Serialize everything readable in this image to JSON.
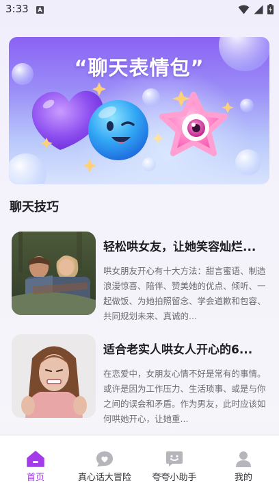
{
  "status_bar": {
    "time": "3:33",
    "a_badge": "A"
  },
  "banner": {
    "title": "“聊天表情包”"
  },
  "section": {
    "title": "聊天技巧"
  },
  "articles": [
    {
      "title": "轻松哄女友，让她笑容灿烂...",
      "description": "哄女朋友开心有十大方法：甜言蜜语、制造浪漫惊喜、陪伴、赞美她的优点、倾听、一起做饭、为她拍照留念、学会道歉和包容、共同规划未来、真诚的..."
    },
    {
      "title": "适合老实人哄女人开心的6...",
      "description": "在恋爱中，女朋友心情不好是常有的事情。或许是因为工作压力、生活琐事、或是与你之间的误会和矛盾。作为男友，此时应该如何哄她开心，让她重..."
    }
  ],
  "bottom_nav": {
    "items": [
      {
        "label": "首页",
        "icon": "home-icon",
        "active": true
      },
      {
        "label": "真心话大冒险",
        "icon": "heart-chat-icon",
        "active": false
      },
      {
        "label": "夸夸小助手",
        "icon": "smile-chat-icon",
        "active": false
      },
      {
        "label": "我的",
        "icon": "user-icon",
        "active": false
      }
    ]
  },
  "colors": {
    "accent": "#a33be8",
    "nav_inactive": "#b5b5bb"
  }
}
